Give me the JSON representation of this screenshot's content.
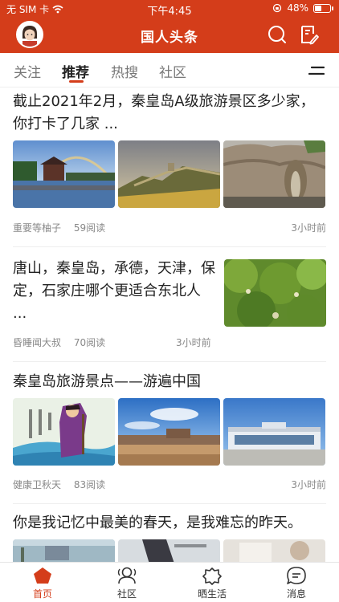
{
  "status": {
    "carrier": "无 SIM 卡",
    "time": "下午4:45",
    "battery": "48%",
    "battery_level": 0.48
  },
  "header": {
    "title": "国人头条"
  },
  "tabs": [
    {
      "label": "关注"
    },
    {
      "label": "推荐"
    },
    {
      "label": "热搜"
    },
    {
      "label": "社区"
    }
  ],
  "articles": [
    {
      "title": "截止2021年2月，秦皇岛A级旅游景区多少家，你打卡了几家 ...",
      "author": "重要等柚子",
      "reads": "59阅读",
      "time": "3小时前"
    },
    {
      "title": "唐山，秦皇岛，承德，天津，保定，石家庄哪个更适合东北人 ...",
      "author": "昏睡闻大叔",
      "reads": "70阅读",
      "time": "3小时前"
    },
    {
      "title": "秦皇岛旅游景点——游遍中国",
      "author": "健康卫秋天",
      "reads": "83阅读",
      "time": "3小时前"
    },
    {
      "title": "你是我记忆中最美的春天，是我难忘的昨天。"
    }
  ],
  "nav": [
    {
      "label": "首页"
    },
    {
      "label": "社区"
    },
    {
      "label": "晒生活"
    },
    {
      "label": "消息"
    }
  ],
  "colors": {
    "brand": "#d43d1a"
  }
}
